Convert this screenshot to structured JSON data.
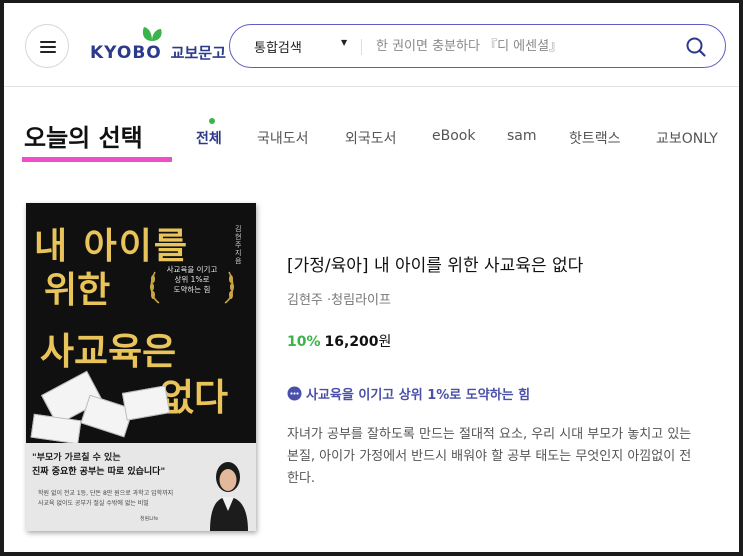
{
  "header": {
    "logo_text": "KYOBO",
    "logo_text_ko": "교보문고",
    "search": {
      "category": "통합검색",
      "placeholder": "한 권이면 충분하다 『디 에센셜』"
    }
  },
  "section": {
    "title": "오늘의 선택",
    "tabs": [
      {
        "label": "전체",
        "active": true
      },
      {
        "label": "국내도서"
      },
      {
        "label": "외국도서"
      },
      {
        "label": "eBook"
      },
      {
        "label": "sam"
      },
      {
        "label": "핫트랙스"
      },
      {
        "label": "교보ONLY"
      }
    ]
  },
  "book": {
    "title": "[가정/육아] 내 아이를 위한 사교육은 없다",
    "author_publisher": "김현주 ·청림라이프",
    "discount": "10%",
    "price": "16,200",
    "currency": "원",
    "highlight": "사교육을 이기고 상위 1%로 도약하는 힘",
    "description": "자녀가 공부를 잘하도록 만드는 절대적 요소, 우리 시대 부모가 놓치고 있는 본질, 아이가 가정에서 반드시 배워야 할 공부 태도는 무엇인지 아낌없이 전한다.",
    "cover": {
      "title_line1": "내 아이를",
      "title_line2": "위한",
      "title_line3": "사교육은",
      "title_line4": "없다",
      "author": "김현주 지음",
      "badge_line1": "사교육을 이기고",
      "badge_line2": "상위 1%로",
      "badge_line3": "도약하는 힘",
      "quote_line1": "\"부모가 가르칠 수 있는",
      "quote_line2": "진짜 중요한 공부는 따로 있습니다\"",
      "sub_line1": "학원 없이 전교 1등, 단돈 8만 원으로 과학고 입학까지",
      "sub_line2": "사교육 없이도 공부가 절실 수밖에 없는 비밀",
      "publisher": "청림Life"
    }
  },
  "colors": {
    "brand_navy": "#2c3a8c",
    "search_border": "#5e5ec2",
    "accent_pink": "#f04ec9",
    "discount_green": "#3ab34a",
    "highlight_blue": "#4a50a8"
  }
}
